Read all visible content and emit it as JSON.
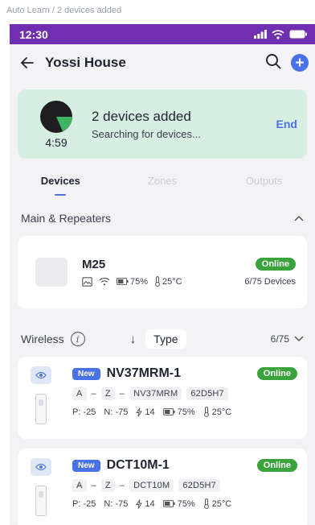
{
  "caption": "Auto Learn / 2 devices added",
  "statusbar": {
    "time": "12:30"
  },
  "header": {
    "title": "Yossi House",
    "add_label": "+"
  },
  "banner": {
    "timer": "4:59",
    "title": "2 devices added",
    "subtitle": "Searching for devices...",
    "end_label": "End"
  },
  "tabs": [
    {
      "label": "Devices",
      "active": true
    },
    {
      "label": "Zones"
    },
    {
      "label": "Outputs"
    }
  ],
  "main_section": {
    "title": "Main & Repeaters",
    "device": {
      "name": "M25",
      "battery": "75%",
      "temperature": "25°C",
      "status": "Online",
      "device_count": "6/75 Devices"
    }
  },
  "wireless": {
    "title": "Wireless",
    "info_label": "i",
    "sort_label": "↓",
    "type_label": "Type",
    "count": "6/75",
    "devices": [
      {
        "badge": "New",
        "name": "NV37MRM-1",
        "status": "Online",
        "chips": [
          "A",
          "–",
          "Z",
          "–",
          "NV37MRM",
          "62D5H7"
        ],
        "p": "P: -25",
        "n": "N: -75",
        "signal": "14",
        "battery": "75%",
        "temperature": "25°C"
      },
      {
        "badge": "New",
        "name": "DCT10M-1",
        "status": "Online",
        "chips": [
          "A",
          "–",
          "Z",
          "–",
          "DCT10M",
          "62D5H7"
        ],
        "p": "P: -25",
        "n": "N: -75",
        "signal": "14",
        "battery": "75%",
        "temperature": "25°C"
      }
    ]
  },
  "colors": {
    "status_bar": "#6f2fb0",
    "accent": "#4a72e8",
    "online": "#3aa33c",
    "banner": "#d7eee3"
  }
}
